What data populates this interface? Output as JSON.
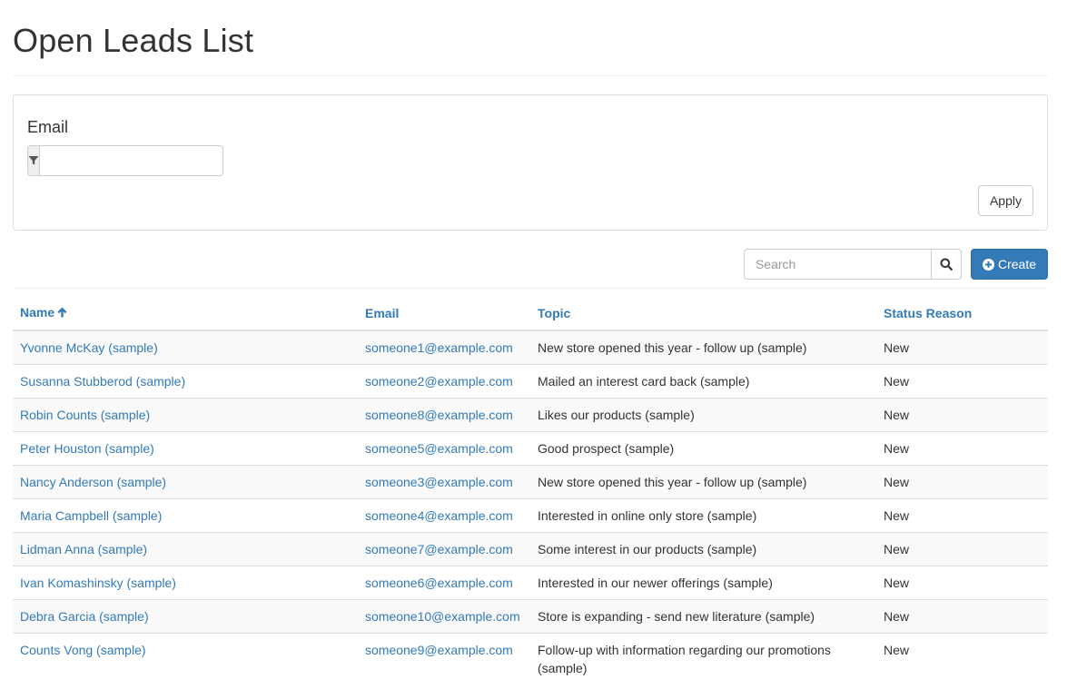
{
  "page": {
    "title": "Open Leads List"
  },
  "filter": {
    "label": "Email",
    "input_value": "",
    "filter_icon": "filter-icon",
    "apply_label": "Apply"
  },
  "toolbar": {
    "search_placeholder": "Search",
    "search_icon": "search-icon",
    "create_label": "Create",
    "create_icon": "plus-circle-icon"
  },
  "colors": {
    "link": "#337ab7",
    "primary_button": "#337ab7",
    "stripe": "#f9f9f9",
    "border": "#dddddd"
  },
  "table": {
    "columns": [
      {
        "key": "name",
        "label": "Name",
        "sorted": "ascending",
        "sort_icon": "arrow-up-icon"
      },
      {
        "key": "email",
        "label": "Email"
      },
      {
        "key": "topic",
        "label": "Topic"
      },
      {
        "key": "status",
        "label": "Status Reason"
      }
    ],
    "rows": [
      {
        "name": "Yvonne McKay (sample)",
        "email": "someone1@example.com",
        "topic": "New store opened this year - follow up (sample)",
        "status": "New"
      },
      {
        "name": "Susanna Stubberod (sample)",
        "email": "someone2@example.com",
        "topic": "Mailed an interest card back (sample)",
        "status": "New"
      },
      {
        "name": "Robin Counts (sample)",
        "email": "someone8@example.com",
        "topic": "Likes our products (sample)",
        "status": "New"
      },
      {
        "name": "Peter Houston (sample)",
        "email": "someone5@example.com",
        "topic": "Good prospect (sample)",
        "status": "New"
      },
      {
        "name": "Nancy Anderson (sample)",
        "email": "someone3@example.com",
        "topic": "New store opened this year - follow up (sample)",
        "status": "New"
      },
      {
        "name": "Maria Campbell (sample)",
        "email": "someone4@example.com",
        "topic": "Interested in online only store (sample)",
        "status": "New"
      },
      {
        "name": "Lidman Anna (sample)",
        "email": "someone7@example.com",
        "topic": "Some interest in our products (sample)",
        "status": "New"
      },
      {
        "name": "Ivan Komashinsky (sample)",
        "email": "someone6@example.com",
        "topic": "Interested in our newer offerings (sample)",
        "status": "New"
      },
      {
        "name": "Debra Garcia (sample)",
        "email": "someone10@example.com",
        "topic": "Store is expanding - send new literature (sample)",
        "status": "New"
      },
      {
        "name": "Counts Vong (sample)",
        "email": "someone9@example.com",
        "topic": "Follow-up with information regarding our promotions (sample)",
        "status": "New"
      }
    ]
  }
}
